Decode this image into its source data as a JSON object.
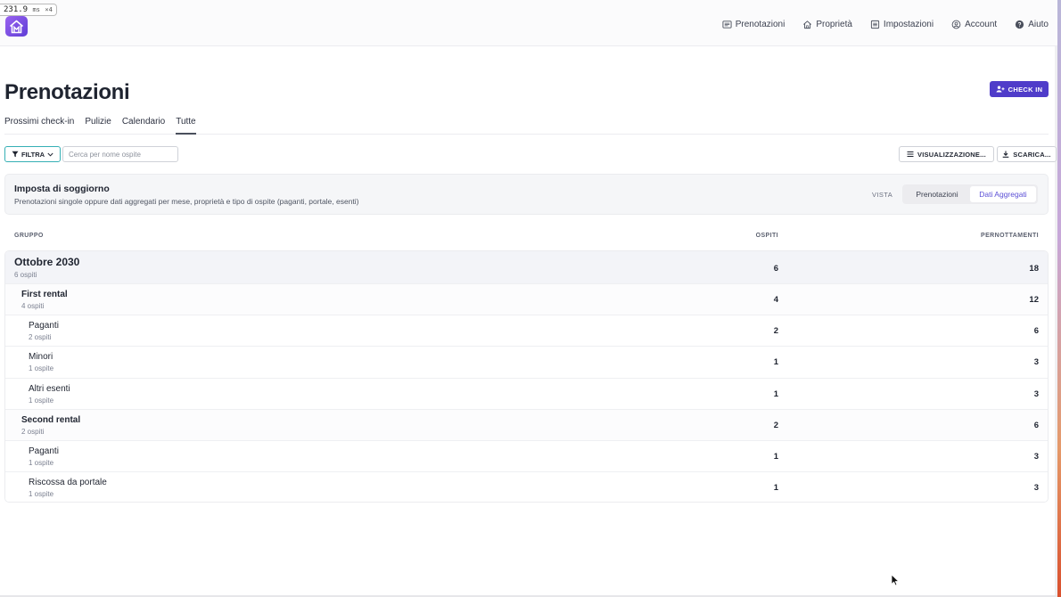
{
  "perf": {
    "value": "231.9",
    "unit": "ms",
    "extra": "×4"
  },
  "nav": [
    {
      "label": "Prenotazioni",
      "icon": "list-icon"
    },
    {
      "label": "Proprietà",
      "icon": "home-icon"
    },
    {
      "label": "Impostazioni",
      "icon": "settings-list-icon"
    },
    {
      "label": "Account",
      "icon": "user-circle-icon"
    },
    {
      "label": "Aiuto",
      "icon": "help-icon"
    }
  ],
  "header": {
    "title": "Prenotazioni",
    "checkin_label": "CHECK IN"
  },
  "tabs": [
    {
      "label": "Prossimi check-in",
      "active": false
    },
    {
      "label": "Pulizie",
      "active": false
    },
    {
      "label": "Calendario",
      "active": false
    },
    {
      "label": "Tutte",
      "active": true
    }
  ],
  "toolbar": {
    "filter_label": "FILTRA",
    "search_placeholder": "Cerca per nome ospite",
    "view_label": "VISUALIZZAZIONE...",
    "download_label": "SCARICA..."
  },
  "panel": {
    "title": "Imposta di soggiorno",
    "subtitle": "Prenotazioni singole oppure dati aggregati per mese, proprietà e tipo di ospite (paganti, portale, esenti)",
    "vista_label": "VISTA",
    "options": [
      {
        "label": "Prenotazioni",
        "active": false
      },
      {
        "label": "Dati Aggregati",
        "active": true
      }
    ]
  },
  "table": {
    "headers": {
      "group": "GRUPPO",
      "guests": "OSPITI",
      "nights": "PERNOTTAMENTI"
    },
    "rows": [
      {
        "level": 0,
        "name": "Ottobre 2030",
        "count": "6 ospiti",
        "guests": "6",
        "nights": "18"
      },
      {
        "level": 1,
        "name": "First rental",
        "count": "4 ospiti",
        "guests": "4",
        "nights": "12"
      },
      {
        "level": 2,
        "name": "Paganti",
        "count": "2 ospiti",
        "guests": "2",
        "nights": "6"
      },
      {
        "level": 2,
        "name": "Minori",
        "count": "1 ospite",
        "guests": "1",
        "nights": "3"
      },
      {
        "level": 2,
        "name": "Altri esenti",
        "count": "1 ospite",
        "guests": "1",
        "nights": "3"
      },
      {
        "level": 1,
        "name": "Second rental",
        "count": "2 ospiti",
        "guests": "2",
        "nights": "6"
      },
      {
        "level": 2,
        "name": "Paganti",
        "count": "1 ospite",
        "guests": "1",
        "nights": "3"
      },
      {
        "level": 2,
        "name": "Riscossa da portale",
        "count": "1 ospite",
        "guests": "1",
        "nights": "3"
      }
    ]
  },
  "colors": {
    "accent": "#4f3cc9",
    "filter_border": "#35b0b5",
    "active_segment_text": "#5b4fd6"
  }
}
